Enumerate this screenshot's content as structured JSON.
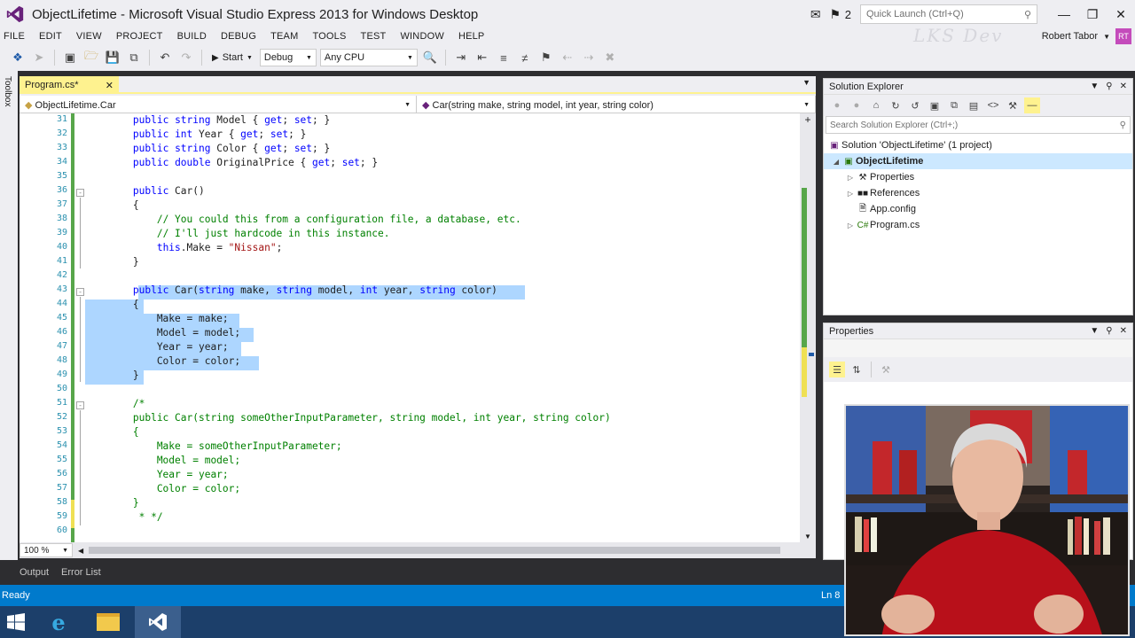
{
  "window": {
    "title": "ObjectLifetime - Microsoft Visual Studio Express 2013 for Windows Desktop",
    "notification_count": "2",
    "quick_launch_placeholder": "Quick Launch (Ctrl+Q)"
  },
  "menu": [
    "FILE",
    "EDIT",
    "VIEW",
    "PROJECT",
    "BUILD",
    "DEBUG",
    "TEAM",
    "TOOLS",
    "TEST",
    "WINDOW",
    "HELP"
  ],
  "user": {
    "name": "Robert Tabor",
    "initials": "RT",
    "watermark": "LKS Dev"
  },
  "toolbar": {
    "start_label": "Start",
    "config_value": "Debug",
    "platform_value": "Any CPU"
  },
  "toolbox_label": "Toolbox",
  "editor": {
    "tab_label": "Program.cs*",
    "nav_left": "ObjectLifetime.Car",
    "nav_right": "Car(string make, string model, int year, string color)",
    "zoom": "100 %"
  },
  "code": {
    "line_numbers": [
      "31",
      "32",
      "33",
      "34",
      "35",
      "36",
      "37",
      "38",
      "39",
      "40",
      "41",
      "42",
      "43",
      "44",
      "45",
      "46",
      "47",
      "48",
      "49",
      "50",
      "51",
      "52",
      "53",
      "54",
      "55",
      "56",
      "57",
      "58",
      "59",
      "60"
    ]
  },
  "bottom_tabs": [
    "Output",
    "Error List"
  ],
  "status": {
    "left": "Ready",
    "right": "Ln 8"
  },
  "solution_explorer": {
    "title": "Solution Explorer",
    "search_placeholder": "Search Solution Explorer (Ctrl+;)",
    "solution": "Solution 'ObjectLifetime' (1 project)",
    "project": "ObjectLifetime",
    "items": [
      "Properties",
      "References",
      "App.config",
      "Program.cs"
    ]
  },
  "properties": {
    "title": "Properties"
  },
  "colors": {
    "accent": "#007acc",
    "tab_active": "#fef28f",
    "selection": "#add6ff",
    "keyword": "#0000ff",
    "type": "#2b91af",
    "comment": "#008000",
    "string": "#a31515"
  }
}
